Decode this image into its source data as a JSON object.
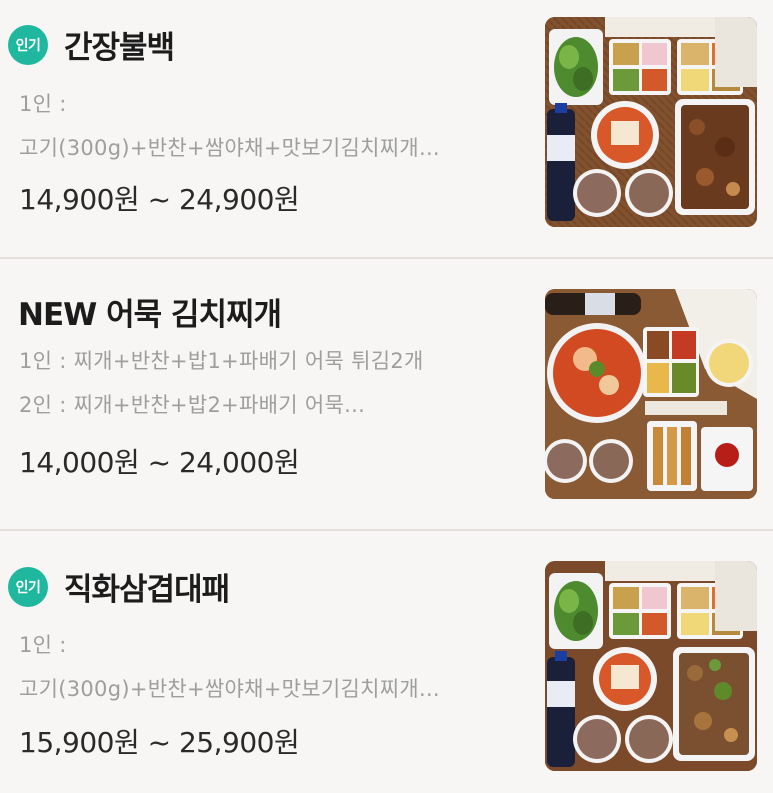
{
  "menu_items": [
    {
      "badge": "인기",
      "title": "간장불백",
      "desc_line1": "1인 :",
      "desc_line2": "고기(300g)+반찬+쌈야채+맛보기김치찌개...",
      "price": "14,900원 ~ 24,900원",
      "image_label": "밥이랑 간장불백 도시락 세트"
    },
    {
      "badge": "",
      "title": "NEW 어묵 김치찌개",
      "desc_line1": "1인 : 찌개+반찬+밥1+파배기 어묵 튀김2개",
      "desc_line2": "2인 : 찌개+반찬+밥2+파배기 어묵...",
      "price": "14,000원 ~ 24,000원",
      "image_label": "어묵 김치찌개 세트"
    },
    {
      "badge": "인기",
      "title": "직화삼겹대패",
      "desc_line1": "1인 :",
      "desc_line2": "고기(300g)+반찬+쌈야채+맛보기김치찌개...",
      "price": "15,900원 ~ 25,900원",
      "image_label": "직화삼겹대패 도시락 세트"
    }
  ],
  "colors": {
    "badge": "#1fb89f",
    "background": "#f7f6f4",
    "title": "#1c1c1c",
    "desc": "#9e9e9e",
    "price": "#2a2a2a",
    "divider": "#e4e0d9"
  }
}
